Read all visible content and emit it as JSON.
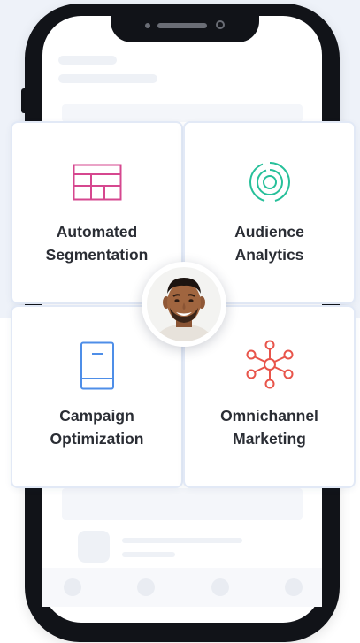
{
  "cards": [
    {
      "line1": "Automated",
      "line2": "Segmentation",
      "icon": "table-grid-icon",
      "color": "#d6478f"
    },
    {
      "line1": "Audience",
      "line2": "Analytics",
      "icon": "concentric-target-icon",
      "color": "#27c09a"
    },
    {
      "line1": "Campaign",
      "line2": "Optimization",
      "icon": "book-icon",
      "color": "#4e8ee8"
    },
    {
      "line1": "Omnichannel",
      "line2": "Marketing",
      "icon": "network-hub-icon",
      "color": "#e8544a"
    }
  ],
  "center_avatar": {
    "icon": "person-avatar"
  },
  "colors": {
    "background_band": "#eef2f9",
    "phone_frame": "#111318",
    "card_border": "#e2e9f6",
    "title_text": "#2a2d34"
  }
}
